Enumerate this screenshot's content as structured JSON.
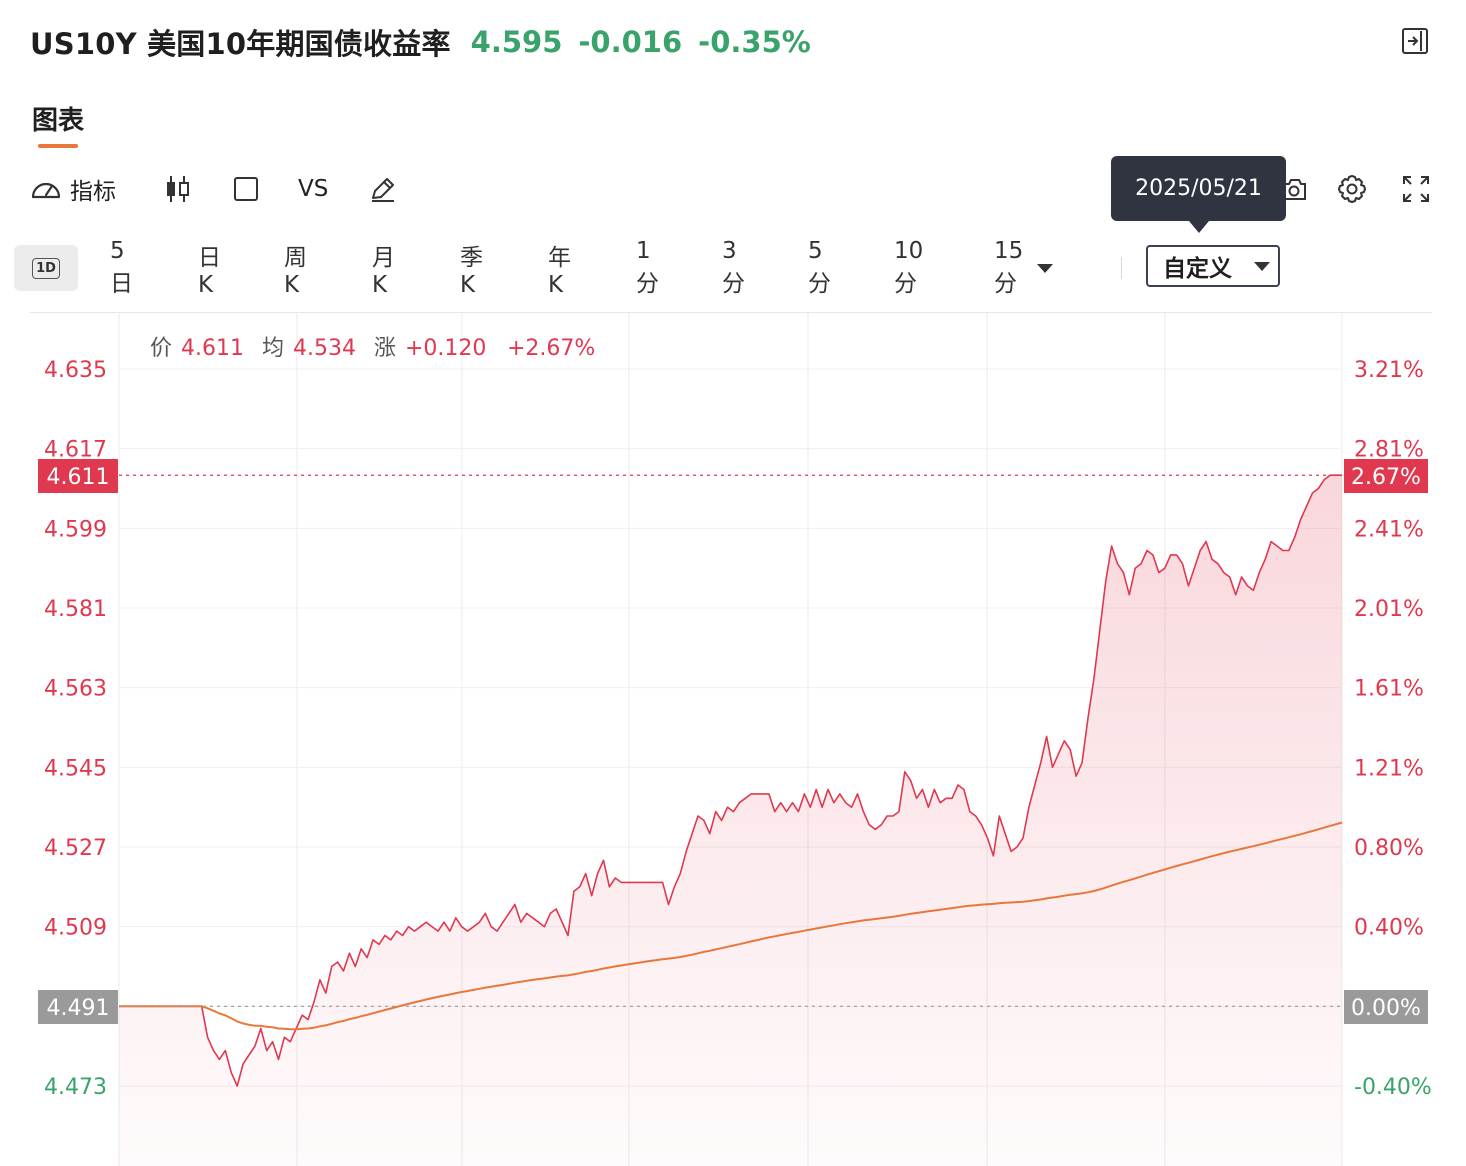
{
  "header": {
    "title": "US10Y 美国10年期国债收益率",
    "price": "4.595",
    "change": "-0.016",
    "change_pct": "-0.35%"
  },
  "tab": {
    "label": "图表"
  },
  "toolbar": {
    "indicator_label": "指标",
    "vs_label": "VS",
    "tooltip_date": "2025/05/21"
  },
  "periods": [
    {
      "label": "1D"
    },
    {
      "label": "5日"
    },
    {
      "label": "日K"
    },
    {
      "label": "周K"
    },
    {
      "label": "月K"
    },
    {
      "label": "季K"
    },
    {
      "label": "年K"
    },
    {
      "label": "1分"
    },
    {
      "label": "3分"
    },
    {
      "label": "5分"
    },
    {
      "label": "10分"
    },
    {
      "label": "15分"
    }
  ],
  "custom_label": "自定义",
  "info": {
    "price_label": "价",
    "price_value": "4.611",
    "avg_label": "均",
    "avg_value": "4.534",
    "chg_label": "涨",
    "chg_value": "+0.120",
    "chg_pct": "+2.67%"
  },
  "chart_data": {
    "type": "line",
    "y_ticks_left": [
      "4.635",
      "4.617",
      "4.599",
      "4.581",
      "4.563",
      "4.545",
      "4.527",
      "4.509",
      "4.491",
      "4.473"
    ],
    "y_ticks_right": [
      "3.21%",
      "2.81%",
      "2.41%",
      "2.01%",
      "1.61%",
      "1.21%",
      "0.80%",
      "0.40%",
      "0.00%",
      "-0.40%"
    ],
    "ylim": [
      4.473,
      4.635
    ],
    "base_value": 4.491,
    "current_value": 4.611,
    "base_label": "4.491",
    "base_pct": "0.00%",
    "current_label": "4.611",
    "current_pct": "2.67%",
    "colors": {
      "up": "#e0384f",
      "down": "#3aa36b",
      "avg": "#e8773a",
      "base": "#999999"
    },
    "series": [
      {
        "values": [
          4.491,
          4.491,
          4.491,
          4.491,
          4.491,
          4.491,
          4.491,
          4.491,
          4.491,
          4.491,
          4.491,
          4.491,
          4.491,
          4.491,
          4.491,
          4.484,
          4.481,
          4.479,
          4.481,
          4.476,
          4.473,
          4.478,
          4.48,
          4.482,
          4.486,
          4.481,
          4.483,
          4.479,
          4.484,
          4.483,
          4.486,
          4.489,
          4.488,
          4.492,
          4.497,
          4.494,
          4.5,
          4.501,
          4.499,
          4.503,
          4.5,
          4.504,
          4.502,
          4.506,
          4.505,
          4.507,
          4.506,
          4.508,
          4.507,
          4.509,
          4.508,
          4.509,
          4.51,
          4.509,
          4.508,
          4.51,
          4.508,
          4.511,
          4.509,
          4.508,
          4.509,
          4.51,
          4.512,
          4.509,
          4.508,
          4.51,
          4.512,
          4.514,
          4.51,
          4.512,
          4.511,
          4.51,
          4.509,
          4.512,
          4.513,
          4.51,
          4.507,
          4.517,
          4.518,
          4.521,
          4.516,
          4.521,
          4.524,
          4.518,
          4.52,
          4.519,
          4.519,
          4.519,
          4.519,
          4.519,
          4.519,
          4.519,
          4.519,
          4.514,
          4.518,
          4.521,
          4.526,
          4.53,
          4.534,
          4.533,
          4.53,
          4.535,
          4.533,
          4.536,
          4.535,
          4.537,
          4.538,
          4.539,
          4.539,
          4.539,
          4.539,
          4.535,
          4.537,
          4.535,
          4.537,
          4.535,
          4.539,
          4.536,
          4.54,
          4.536,
          4.54,
          4.537,
          4.539,
          4.537,
          4.536,
          4.539,
          4.535,
          4.532,
          4.531,
          4.532,
          4.534,
          4.534,
          4.535,
          4.544,
          4.542,
          4.538,
          4.54,
          4.536,
          4.54,
          4.537,
          4.538,
          4.538,
          4.541,
          4.54,
          4.535,
          4.534,
          4.532,
          4.529,
          4.525,
          4.534,
          4.53,
          4.526,
          4.527,
          4.529,
          4.536,
          4.541,
          4.546,
          4.552,
          4.545,
          4.548,
          4.551,
          4.549,
          4.543,
          4.546,
          4.556,
          4.565,
          4.576,
          4.587,
          4.595,
          4.591,
          4.589,
          4.584,
          4.59,
          4.591,
          4.594,
          4.593,
          4.589,
          4.59,
          4.593,
          4.593,
          4.591,
          4.586,
          4.59,
          4.594,
          4.596,
          4.592,
          4.591,
          4.589,
          4.588,
          4.584,
          4.588,
          4.586,
          4.585,
          4.589,
          4.592,
          4.596,
          4.595,
          4.594,
          4.594,
          4.597,
          4.601,
          4.604,
          4.607,
          4.608,
          4.61,
          4.611,
          4.611,
          4.611
        ]
      }
    ]
  }
}
